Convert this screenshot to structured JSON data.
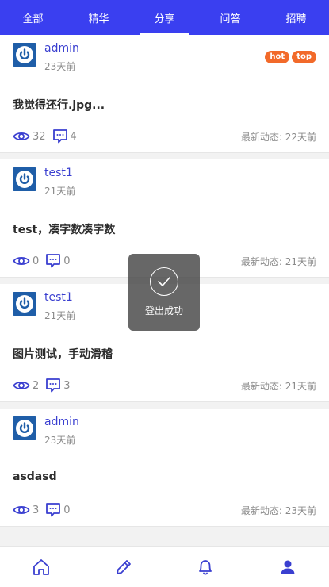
{
  "tabs": [
    {
      "label": "全部",
      "active": false
    },
    {
      "label": "精华",
      "active": false
    },
    {
      "label": "分享",
      "active": true
    },
    {
      "label": "问答",
      "active": false
    },
    {
      "label": "招聘",
      "active": false
    }
  ],
  "posts": [
    {
      "author": "admin",
      "time": "23天前",
      "title": "我觉得还行.jpg...",
      "views": "32",
      "comments": "4",
      "latest": "最新动态: 22天前",
      "badges": [
        "hot",
        "top"
      ]
    },
    {
      "author": "test1",
      "time": "21天前",
      "title": "test，凑字数凑字数",
      "views": "0",
      "comments": "0",
      "latest": "最新动态: 21天前",
      "badges": []
    },
    {
      "author": "test1",
      "time": "21天前",
      "title": "图片测试，手动滑稽",
      "views": "2",
      "comments": "3",
      "latest": "最新动态: 21天前",
      "badges": []
    },
    {
      "author": "admin",
      "time": "23天前",
      "title": "asdasd",
      "views": "3",
      "comments": "0",
      "latest": "最新动态: 23天前",
      "badges": []
    }
  ],
  "toast": {
    "text": "登出成功",
    "icon": "check-circle-icon"
  },
  "bottom_nav": [
    {
      "icon": "home-icon"
    },
    {
      "icon": "edit-icon"
    },
    {
      "icon": "bell-icon"
    },
    {
      "icon": "user-icon"
    }
  ],
  "colors": {
    "accent": "#3a3ff0",
    "badge": "#f26a2a"
  }
}
